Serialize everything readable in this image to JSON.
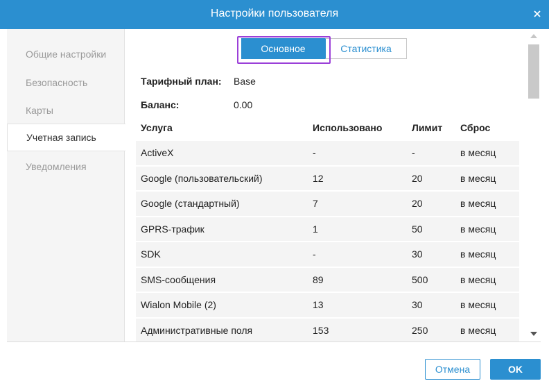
{
  "window": {
    "title": "Настройки пользователя"
  },
  "sidebar": {
    "items": [
      {
        "label": "Общие настройки"
      },
      {
        "label": "Безопасность"
      },
      {
        "label": "Карты"
      },
      {
        "label": "Учетная запись",
        "active": true
      },
      {
        "label": "Уведомления"
      }
    ]
  },
  "tabs": [
    {
      "label": "Основное",
      "active": true
    },
    {
      "label": "Статистика"
    }
  ],
  "account": {
    "plan_label": "Тарифный план:",
    "plan_value": "Base",
    "balance_label": "Баланс:",
    "balance_value": "0.00"
  },
  "services_table": {
    "headers": [
      "Услуга",
      "Использовано",
      "Лимит",
      "Сброс"
    ],
    "rows": [
      [
        "ActiveX",
        "-",
        "-",
        "в месяц"
      ],
      [
        "Google (пользовательский)",
        "12",
        "20",
        "в месяц"
      ],
      [
        "Google (стандартный)",
        "7",
        "20",
        "в месяц"
      ],
      [
        "GPRS-трафик",
        "1",
        "50",
        "в месяц"
      ],
      [
        "SDK",
        "-",
        "30",
        "в месяц"
      ],
      [
        "SMS-сообщения",
        "89",
        "500",
        "в месяц"
      ],
      [
        "Wialon Mobile (2)",
        "13",
        "30",
        "в месяц"
      ],
      [
        "Административные поля",
        "153",
        "250",
        "в месяц"
      ]
    ]
  },
  "footer": {
    "cancel_label": "Отмена",
    "ok_label": "OK"
  },
  "colors": {
    "accent": "#2b8fd0",
    "highlight": "#9b3fd8"
  },
  "icons": {
    "close": "close-icon",
    "scroll_up": "arrow-up-icon",
    "scroll_down": "arrow-down-icon"
  }
}
